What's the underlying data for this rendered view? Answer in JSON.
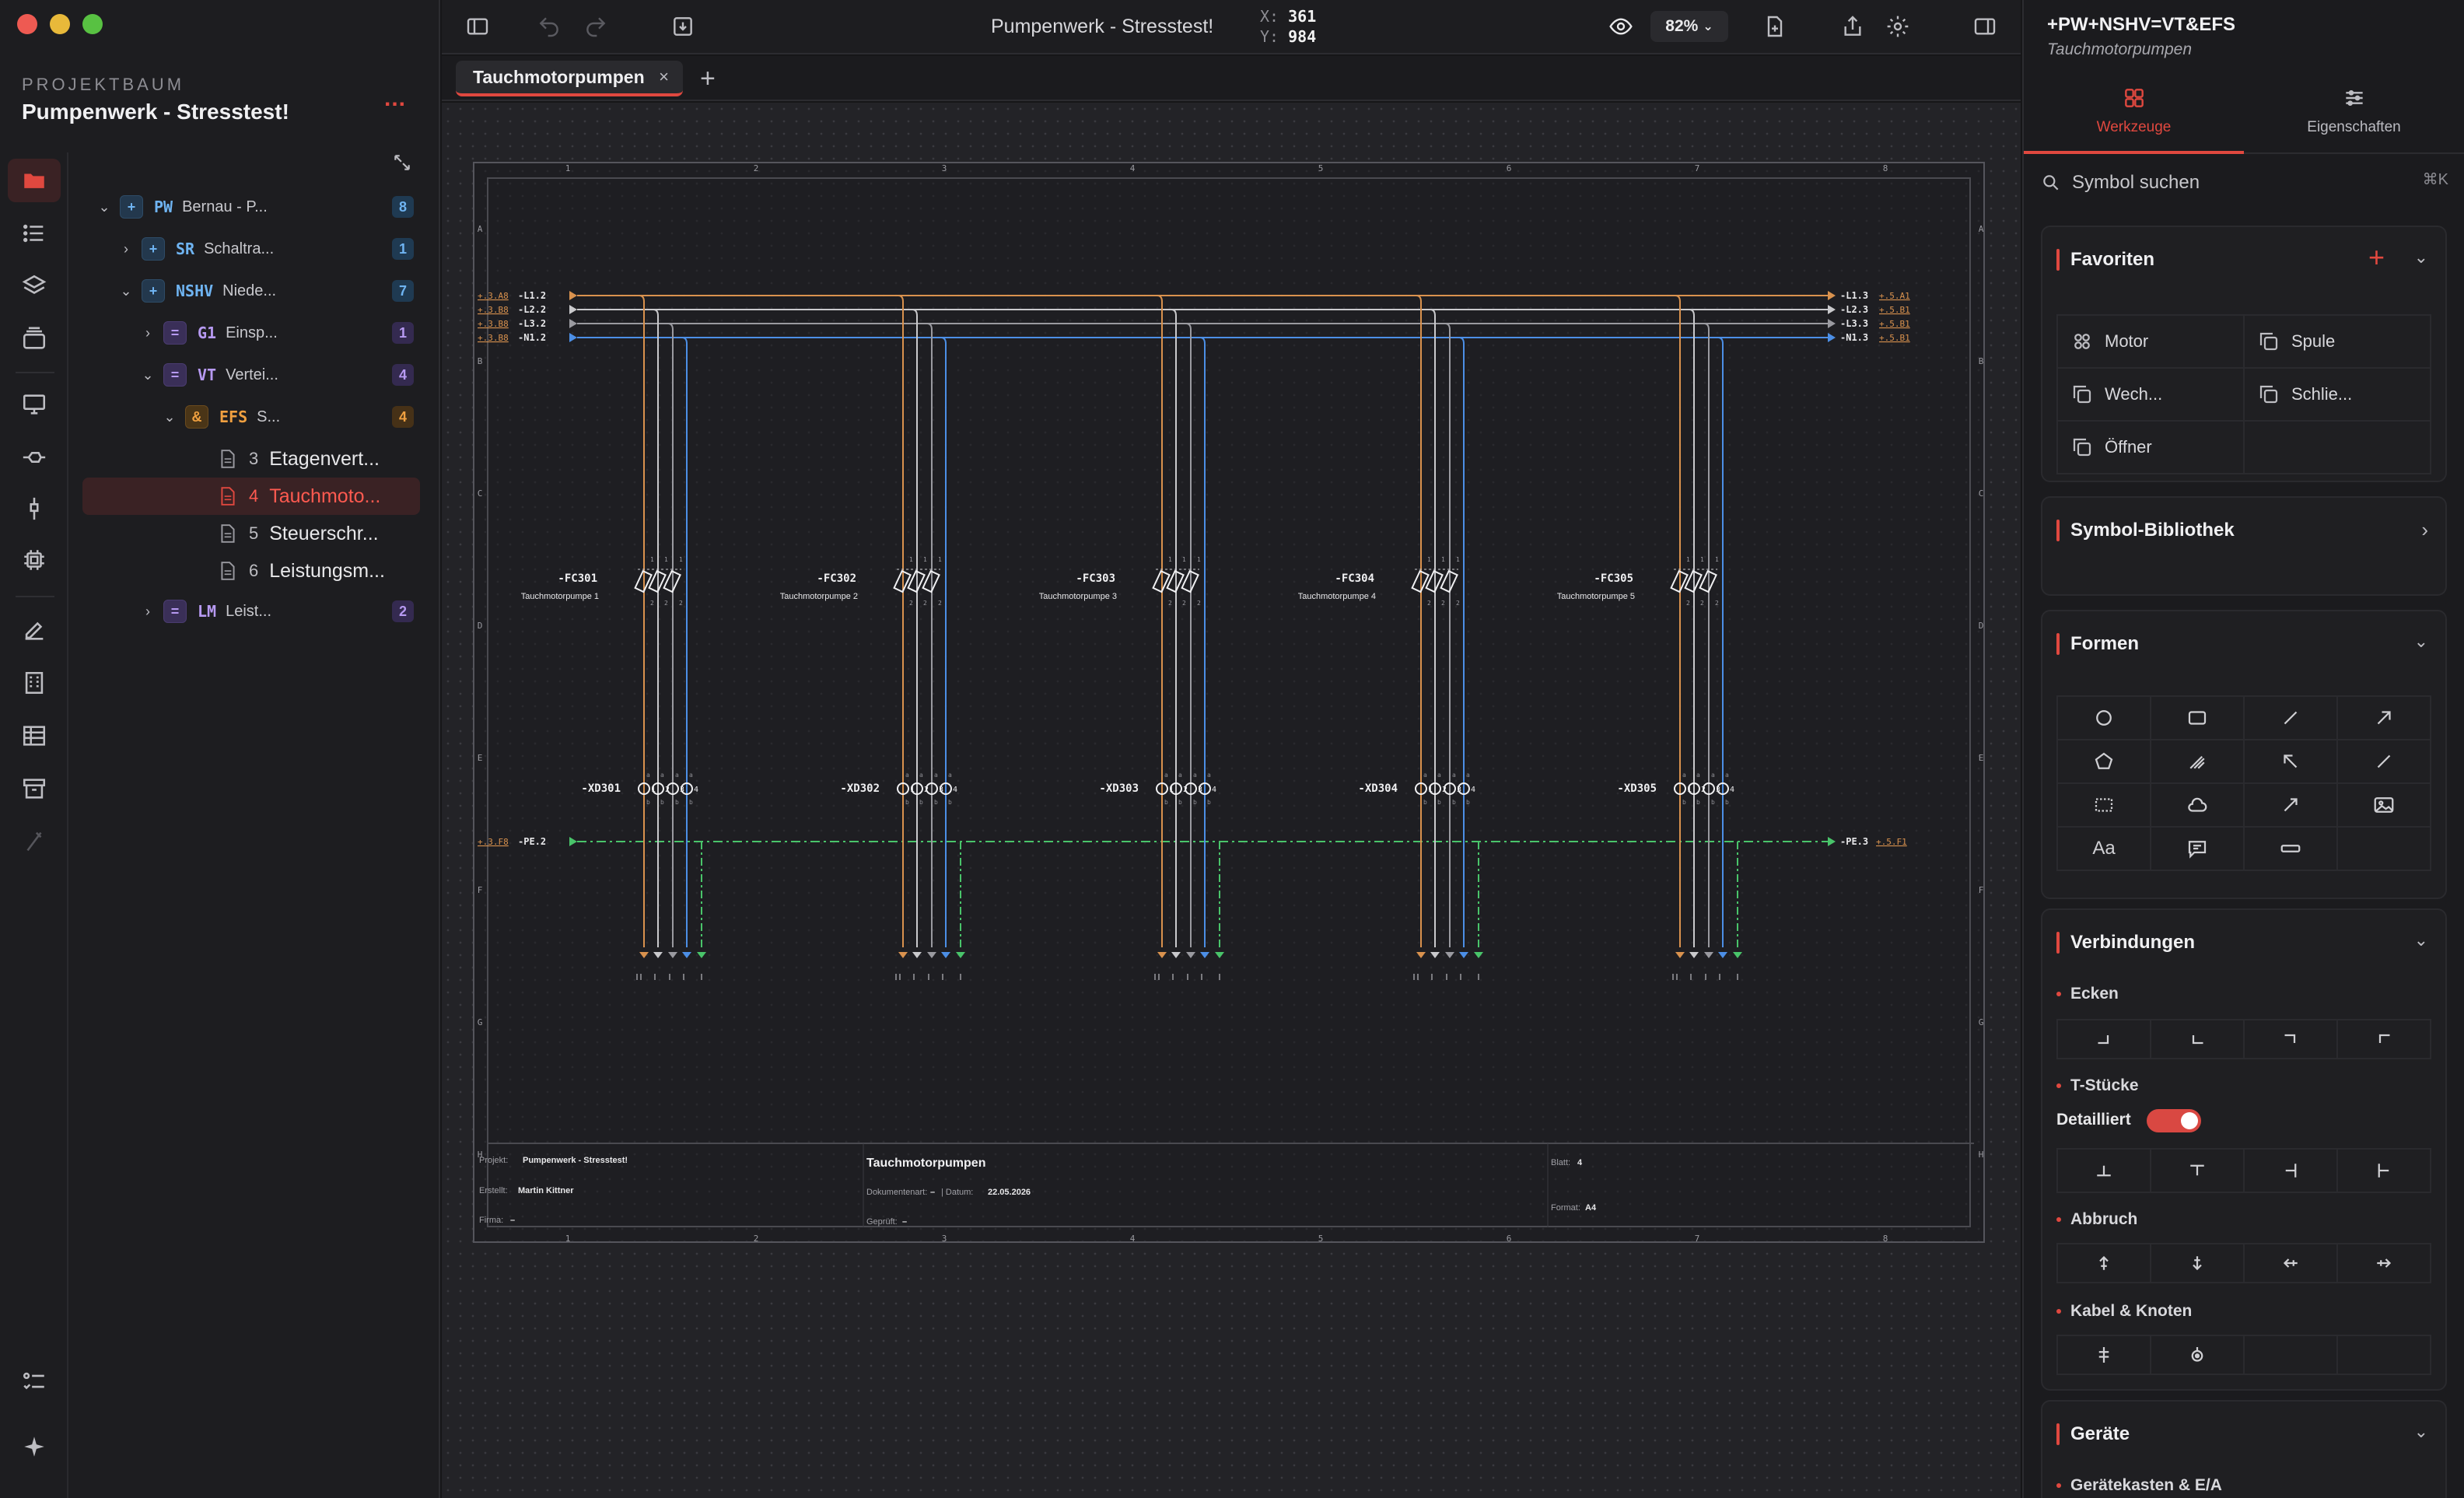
{
  "sidebar": {
    "section_label": "PROJEKTBAUM",
    "project_title": "Pumpenwerk - Stresstest!",
    "more": "...",
    "tree": [
      {
        "code": "PW",
        "name": "Bernau - P...",
        "count": "8"
      },
      {
        "code": "SR",
        "name": "Schaltra...",
        "count": "1"
      },
      {
        "code": "NSHV",
        "name": "Niede...",
        "count": "7"
      },
      {
        "code": "G1",
        "name": "Einsp...",
        "count": "1"
      },
      {
        "code": "VT",
        "name": "Vertei...",
        "count": "4"
      },
      {
        "code": "EFS",
        "name": "S...",
        "count": "4"
      },
      {
        "num": "3",
        "name": "Etagenvert..."
      },
      {
        "num": "4",
        "name": "Tauchmoto..."
      },
      {
        "num": "5",
        "name": "Steuerschr..."
      },
      {
        "num": "6",
        "name": "Leistungsm..."
      },
      {
        "code": "LM",
        "name": "Leist...",
        "count": "2"
      }
    ],
    "tree_symbols": {
      "plus": "+",
      "eq": "=",
      "amp": "&"
    }
  },
  "toolbar": {
    "title": "Pumpenwerk - Stresstest!",
    "coord_x_label": "X:",
    "coord_x": "361",
    "coord_y_label": "Y:",
    "coord_y": "984",
    "zoom": "82%"
  },
  "tabs": {
    "active": "Tauchmotorpumpen",
    "close": "×",
    "add": "+"
  },
  "schematic": {
    "columns": [
      "1",
      "2",
      "3",
      "4",
      "5",
      "6",
      "7",
      "8"
    ],
    "rows": [
      "A",
      "B",
      "C",
      "D",
      "E",
      "F",
      "G",
      "H"
    ],
    "bus_left": [
      {
        "ref": "+.3.A8",
        "label": "-L1.2"
      },
      {
        "ref": "+.3.B8",
        "label": "-L2.2"
      },
      {
        "ref": "+.3.B8",
        "label": "-L3.2"
      },
      {
        "ref": "+.3.B8",
        "label": "-N1.2"
      }
    ],
    "bus_right": [
      {
        "label": "-L1.3",
        "ref": "+.5.A1"
      },
      {
        "label": "-L2.3",
        "ref": "+.5.B1"
      },
      {
        "label": "-L3.3",
        "ref": "+.5.B1"
      },
      {
        "label": "-N1.3",
        "ref": "+.5.B1"
      }
    ],
    "pe_left": {
      "ref": "+.3.F8",
      "label": "-PE.2"
    },
    "pe_right": {
      "label": "-PE.3",
      "ref": "+.5.F1"
    },
    "breakers": [
      {
        "tag": "-FC301",
        "desc": "Tauchmotorpumpe 1",
        "terminal": "-XD301"
      },
      {
        "tag": "-FC302",
        "desc": "Tauchmotorpumpe 2",
        "terminal": "-XD302"
      },
      {
        "tag": "-FC303",
        "desc": "Tauchmotorpumpe 3",
        "terminal": "-XD303"
      },
      {
        "tag": "-FC304",
        "desc": "Tauchmotorpumpe 4",
        "terminal": "-XD304"
      },
      {
        "tag": "-FC305",
        "desc": "Tauchmotorpumpe 5",
        "terminal": "-XD305"
      }
    ],
    "pin_top": "1",
    "pin_bottom": "2",
    "terminal_pins": [
      "1",
      "2",
      "3",
      "4"
    ],
    "terminal_a": "a",
    "terminal_b": "b",
    "title_block": {
      "project_label": "Projekt:",
      "project": "Pumpenwerk - Stresstest!",
      "created_label": "Erstellt:",
      "created": "Martin Kittner",
      "company_label": "Firma:",
      "company": "–",
      "sheet_title": "Tauchmotorpumpen",
      "doctype_label": "Dokumentenart:",
      "doctype": "–",
      "date_label": "| Datum:",
      "date": "22.05.2026",
      "checked_label": "Geprüft:",
      "checked": "–",
      "page_label": "Blatt:",
      "page": "4",
      "format_label": "Format:",
      "format": "A4"
    },
    "colors": {
      "l1": "#d9924e",
      "l2": "#c9c9cc",
      "l3": "#9a9aa0",
      "n": "#4c8fe6",
      "pe": "#49c46a"
    }
  },
  "panel": {
    "path": "+PW+NSHV=VT&EFS",
    "subtitle": "Tauchmotorpumpen",
    "tab_tools": "Werkzeuge",
    "tab_props": "Eigenschaften",
    "search_placeholder": "Symbol suchen",
    "search_kbd": "⌘K",
    "favorites_title": "Favoriten",
    "favorites": [
      "Motor",
      "Spule",
      "Wech...",
      "Schlie...",
      "Öffner"
    ],
    "library_title": "Symbol-Bibliothek",
    "shapes_title": "Formen",
    "shapes_text_tool": "Aa",
    "connections_title": "Verbindungen",
    "corners_label": "Ecken",
    "tees_label": "T-Stücke",
    "detailed_label": "Detailliert",
    "breaks_label": "Abbruch",
    "cables_label": "Kabel & Knoten",
    "devices_title": "Geräte",
    "devices_sub": "Gerätekasten & E/A"
  }
}
